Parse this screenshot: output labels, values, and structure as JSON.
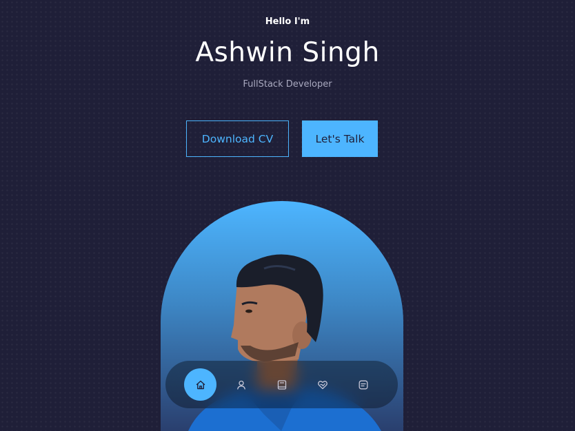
{
  "header": {
    "greeting": "Hello I'm",
    "name": "Ashwin Singh",
    "role": "FullStack Developer"
  },
  "cta": {
    "download_label": "Download CV",
    "talk_label": "Let's Talk"
  },
  "portrait": {
    "alt": "Ashwin Singh"
  },
  "nav": {
    "items": [
      {
        "icon": "home-icon",
        "active": true
      },
      {
        "icon": "user-icon",
        "active": false
      },
      {
        "icon": "book-icon",
        "active": false
      },
      {
        "icon": "services-icon",
        "active": false
      },
      {
        "icon": "message-icon",
        "active": false
      }
    ]
  },
  "colors": {
    "background": "#1f1f38",
    "primary": "#4db5ff",
    "text_light": "#a9a9bf"
  }
}
